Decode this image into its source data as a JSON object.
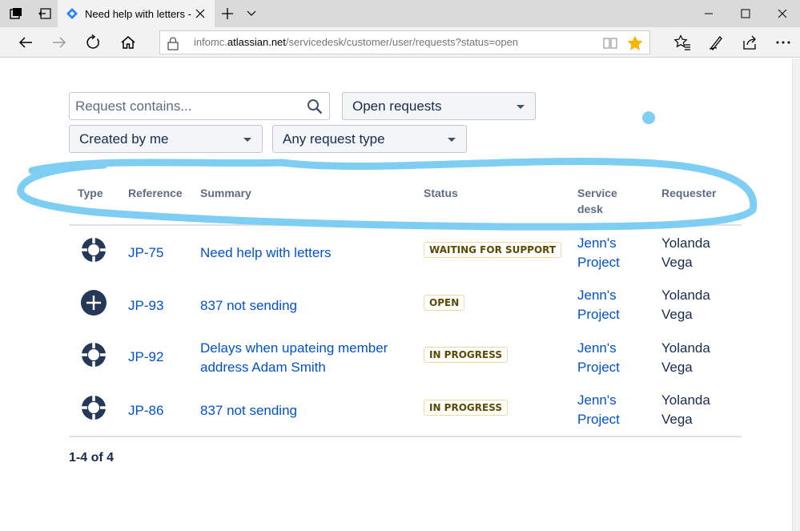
{
  "browser": {
    "tab_title": "Need help with letters -",
    "url_prefix": "infomc.",
    "url_domain": "atlassian.net",
    "url_path": "/servicedesk/customer/user/requests?status=open",
    "icons": [
      "tab-manager-icon",
      "set-tabs-aside-icon",
      "jira-favicon",
      "close-tab-icon",
      "new-tab-icon",
      "tab-preview-icon",
      "minimize-icon",
      "maximize-icon",
      "close-window-icon",
      "back-icon",
      "forward-icon",
      "refresh-icon",
      "home-icon",
      "lock-icon",
      "reading-view-icon",
      "favorite-star-icon",
      "favorites-hub-icon",
      "web-note-icon",
      "share-icon",
      "more-icon"
    ]
  },
  "filters": {
    "search_placeholder": "Request contains...",
    "status_select": "Open requests",
    "creator_select": "Created by me",
    "type_select": "Any request type"
  },
  "table": {
    "headers": {
      "type": "Type",
      "reference": "Reference",
      "summary": "Summary",
      "status": "Status",
      "service_desk_line1": "Service",
      "service_desk_line2": "desk",
      "requester": "Requester"
    },
    "rows": [
      {
        "type_icon": "lifebuoy-icon",
        "reference": "JP-75",
        "summary": "Need help with letters",
        "status": "WAITING FOR SUPPORT",
        "desk_line1": "Jenn's",
        "desk_line2": "Project",
        "requester_line1": "Yolanda",
        "requester_line2": "Vega"
      },
      {
        "type_icon": "plus-circle-icon",
        "reference": "JP-93",
        "summary": "837 not sending",
        "status": "OPEN",
        "desk_line1": "Jenn's",
        "desk_line2": "Project",
        "requester_line1": "Yolanda",
        "requester_line2": "Vega"
      },
      {
        "type_icon": "lifebuoy-icon",
        "reference": "JP-92",
        "summary_line1": "Delays when upateing member",
        "summary_line2": "address Adam Smith",
        "status": "IN PROGRESS",
        "desk_line1": "Jenn's",
        "desk_line2": "Project",
        "requester_line1": "Yolanda",
        "requester_line2": "Vega"
      },
      {
        "type_icon": "lifebuoy-icon",
        "reference": "JP-86",
        "summary": "837 not sending",
        "status": "IN PROGRESS",
        "desk_line1": "Jenn's",
        "desk_line2": "Project",
        "requester_line1": "Yolanda",
        "requester_line2": "Vega"
      }
    ]
  },
  "pagination": "1-4 of 4",
  "annotation": {
    "color": "#7ecdf2",
    "kind": "hand-drawn highlight loop around table header"
  },
  "colors": {
    "link": "#0052cc",
    "text": "#172b4d",
    "header_text": "#5e6c84",
    "lozenge_border": "#f3d9a0",
    "star": "#f2b600"
  }
}
